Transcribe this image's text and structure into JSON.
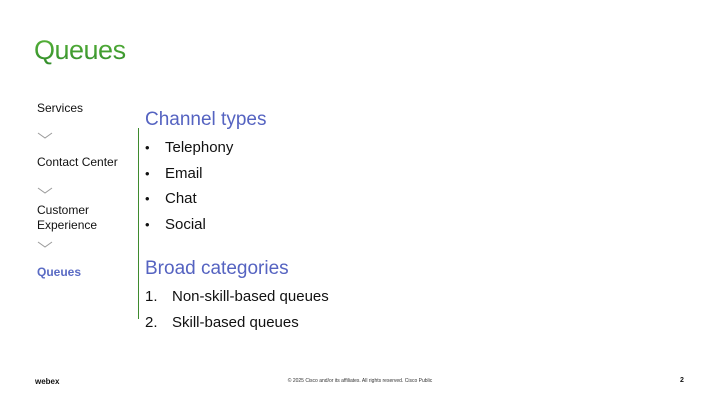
{
  "slide": {
    "title": "Queues",
    "page_number": "2"
  },
  "breadcrumb": {
    "items": [
      {
        "label": "Services",
        "active": false
      },
      {
        "label": "Contact Center",
        "active": false
      },
      {
        "label": "Customer Experience",
        "active": false
      },
      {
        "label": "Queues",
        "active": true
      }
    ]
  },
  "content": {
    "channel_types": {
      "heading": "Channel types",
      "bullet_symbol": "•",
      "items": [
        "Telephony",
        "Email",
        "Chat",
        "Social"
      ]
    },
    "broad_categories": {
      "heading": "Broad categories",
      "items": [
        {
          "number": "1.",
          "text": "Non-skill-based queues"
        },
        {
          "number": "2.",
          "text": "Skill-based queues"
        }
      ]
    }
  },
  "footer": {
    "logo": "webex",
    "copyright": "© 2025 Cisco and/or its affiliates. All rights reserved. Cisco Public"
  },
  "colors": {
    "title_green": "#3e9a2e",
    "heading_blue": "#5563c1",
    "active_nav": "#5a6bc4",
    "divider_green": "#3e8a2e"
  }
}
